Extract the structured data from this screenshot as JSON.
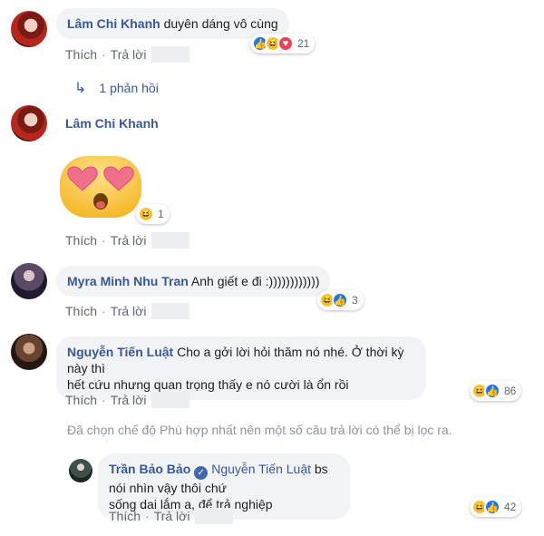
{
  "comments": [
    {
      "name": "Lâm Chi Khanh",
      "text": "duyên dáng vô cùng",
      "like": "Thích",
      "reply": "Trả lời",
      "reaction_count": "21",
      "replies_label": "1 phản hồi"
    },
    {
      "name": "Lâm Chi Khanh",
      "sticker": "heart-eyes-emoji",
      "like": "Thích",
      "reply": "Trả lời",
      "reaction_count": "1"
    },
    {
      "name": "Myra Minh Nhu Tran",
      "text": "Anh giết e đi :))))))))))))",
      "like": "Thích",
      "reply": "Trả lời",
      "reaction_count": "3"
    },
    {
      "name": "Nguyễn Tiến Luật",
      "text_line1": "Cho a gởi lời hỏi thăm nó nhé. Ở thời kỳ này thì",
      "text_line2": "hết cứu nhưng quan trọng thấy e nó cười là ổn rồi",
      "like": "Thích",
      "reply": "Trả lời",
      "reaction_count": "86"
    }
  ],
  "filter_note": "Đã chọn chế độ Phù hợp nhất nên một số câu trả lời có thể bị lọc ra.",
  "reply": {
    "name": "Trần Bảo Bảo",
    "tag": "Nguyễn Tiến Luật",
    "text_line1": "bs nói nhìn vậy thôi chứ",
    "text_line2": "sống dai lắm a, để trả nghiệp",
    "like": "Thích",
    "reply": "Trả lời",
    "reaction_count": "42"
  },
  "colors": {
    "name": "#385898",
    "bubble": "#f2f3f5",
    "like": "#1877f2",
    "haha": "#f7c53b",
    "love": "#f33e58"
  }
}
